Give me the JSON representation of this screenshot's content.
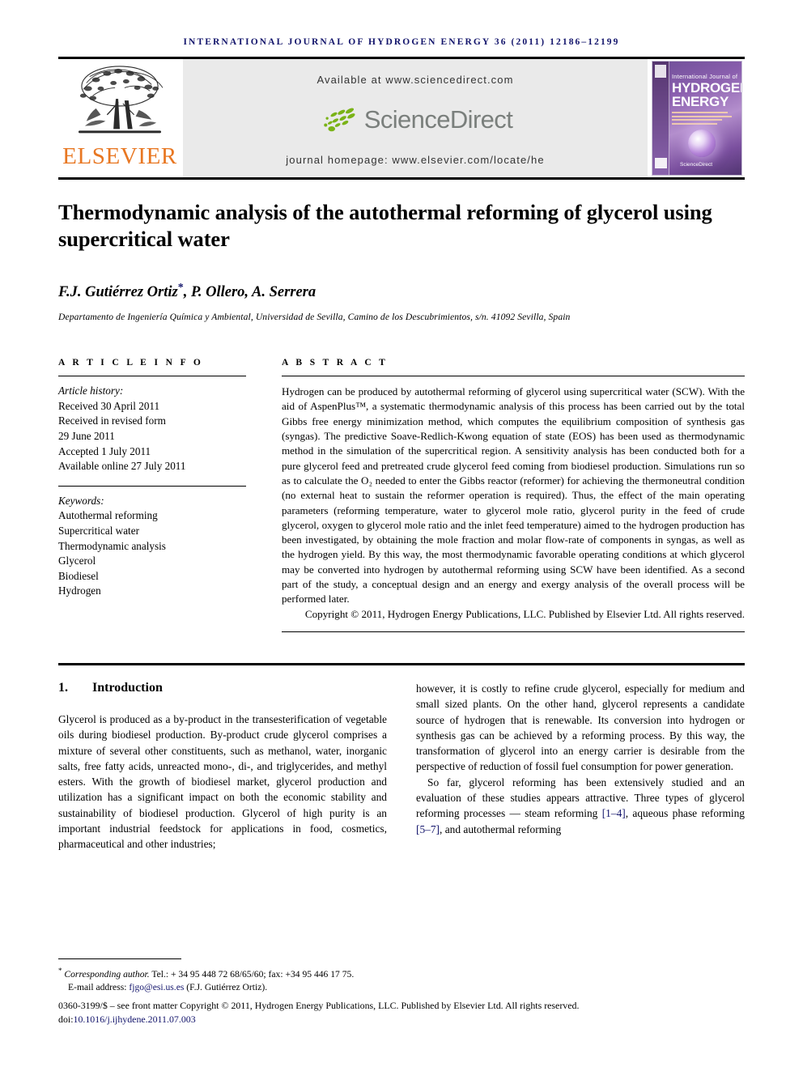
{
  "running_head": "International Journal of Hydrogen Energy 36 (2011) 12186–12199",
  "masthead": {
    "publisher_name": "ELSEVIER",
    "publisher_logo_icon": "elsevier-tree-icon",
    "available_at": "Available at www.sciencedirect.com",
    "sciencedirect_wordmark": "ScienceDirect",
    "sciencedirect_logo_icon": "sciencedirect-leaves-icon",
    "journal_homepage": "journal homepage: www.elsevier.com/locate/he",
    "cover": {
      "line_small": "International Journal of",
      "line_big_1": "HYDROGEN",
      "line_big_2": "ENERGY",
      "sciencedirect_mini": "ScienceDirect",
      "badge_icon": "hydrogen-energy-badge-icon",
      "orb_icon": "glowing-sphere-icon"
    }
  },
  "article": {
    "title": "Thermodynamic analysis of the autothermal reforming of glycerol using supercritical water",
    "authors": "F.J. Gutiérrez Ortiz",
    "authors_rest": ", P. Ollero, A. Serrera",
    "corresponding_marker": "*",
    "affiliation": "Departamento de Ingeniería Química y Ambiental, Universidad de Sevilla, Camino de los Descubrimientos, s/n. 41092 Sevilla, Spain"
  },
  "article_info": {
    "heading": "A R T I C L E  I N F O",
    "history_label": "Article history:",
    "history": [
      "Received 30 April 2011",
      "Received in revised form",
      "29 June 2011",
      "Accepted 1 July 2011",
      "Available online 27 July 2011"
    ],
    "keywords_label": "Keywords:",
    "keywords": [
      "Autothermal reforming",
      "Supercritical water",
      "Thermodynamic analysis",
      "Glycerol",
      "Biodiesel",
      "Hydrogen"
    ]
  },
  "abstract": {
    "heading": "A B S T R A C T",
    "text": "Hydrogen can be produced by autothermal reforming of glycerol using supercritical water (SCW). With the aid of AspenPlus™, a systematic thermodynamic analysis of this process has been carried out by the total Gibbs free energy minimization method, which computes the equilibrium composition of synthesis gas (syngas). The predictive Soave-Redlich-Kwong equation of state (EOS) has been used as thermodynamic method in the simulation of the supercritical region. A sensitivity analysis has been conducted both for a pure glycerol feed and pretreated crude glycerol feed coming from biodiesel production. Simulations run so as to calculate the O₂ needed to enter the Gibbs reactor (reformer) for achieving the thermoneutral condition (no external heat to sustain the reformer operation is required). Thus, the effect of the main operating parameters (reforming temperature, water to glycerol mole ratio, glycerol purity in the feed of crude glycerol, oxygen to glycerol mole ratio and the inlet feed temperature) aimed to the hydrogen production has been investigated, by obtaining the mole fraction and molar flow-rate of components in syngas, as well as the hydrogen yield. By this way, the most thermodynamic favorable operating conditions at which glycerol may be converted into hydrogen by autothermal reforming using SCW have been identified. As a second part of the study, a conceptual design and an energy and exergy analysis of the overall process will be performed later.",
    "copyright": "Copyright © 2011, Hydrogen Energy Publications, LLC. Published by Elsevier Ltd. All rights reserved."
  },
  "body": {
    "section_number": "1.",
    "section_title": "Introduction",
    "left_paragraph": "Glycerol is produced as a by-product in the transesterification of vegetable oils during biodiesel production. By-product crude glycerol comprises a mixture of several other constituents, such as methanol, water, inorganic salts, free fatty acids, unreacted mono-, di-, and triglycerides, and methyl esters. With the growth of biodiesel market, glycerol production and utilization has a significant impact on both the economic stability and sustainability of biodiesel production. Glycerol of high purity is an important industrial feedstock for applications in food, cosmetics, pharmaceutical and other industries;",
    "right_paragraph_1": "however, it is costly to refine crude glycerol, especially for medium and small sized plants. On the other hand, glycerol represents a candidate source of hydrogen that is renewable. Its conversion into hydrogen or synthesis gas can be achieved by a reforming process. By this way, the transformation of glycerol into an energy carrier is desirable from the perspective of reduction of fossil fuel consumption for power generation.",
    "right_paragraph_2a": "So far, glycerol reforming has been extensively studied and an evaluation of these studies appears attractive. Three types of glycerol reforming processes — steam reforming ",
    "right_ref_1": "[1–4]",
    "right_paragraph_2b": ", aqueous phase reforming ",
    "right_ref_2": "[5–7]",
    "right_paragraph_2c": ", and autothermal reforming"
  },
  "footer": {
    "corresponding_label": "Corresponding author.",
    "corresponding_contact": " Tel.: + 34 95 448 72 68/65/60; fax: +34 95 446 17 75.",
    "email_label": "E-mail address:",
    "email": "fjgo@esi.us.es",
    "email_owner": "(F.J. Gutiérrez Ortiz).",
    "issn_line": "0360-3199/$ – see front matter Copyright © 2011, Hydrogen Energy Publications, LLC. Published by Elsevier Ltd. All rights reserved.",
    "doi_prefix": "doi:",
    "doi": "10.1016/j.ijhydene.2011.07.003"
  },
  "colors": {
    "journal_blue": "#12146b",
    "elsevier_orange": "#e87722",
    "banner_gray": "#eaeaea",
    "sciencedirect_gray": "#7a7f7c",
    "sciencedirect_green": "#7ab317"
  }
}
